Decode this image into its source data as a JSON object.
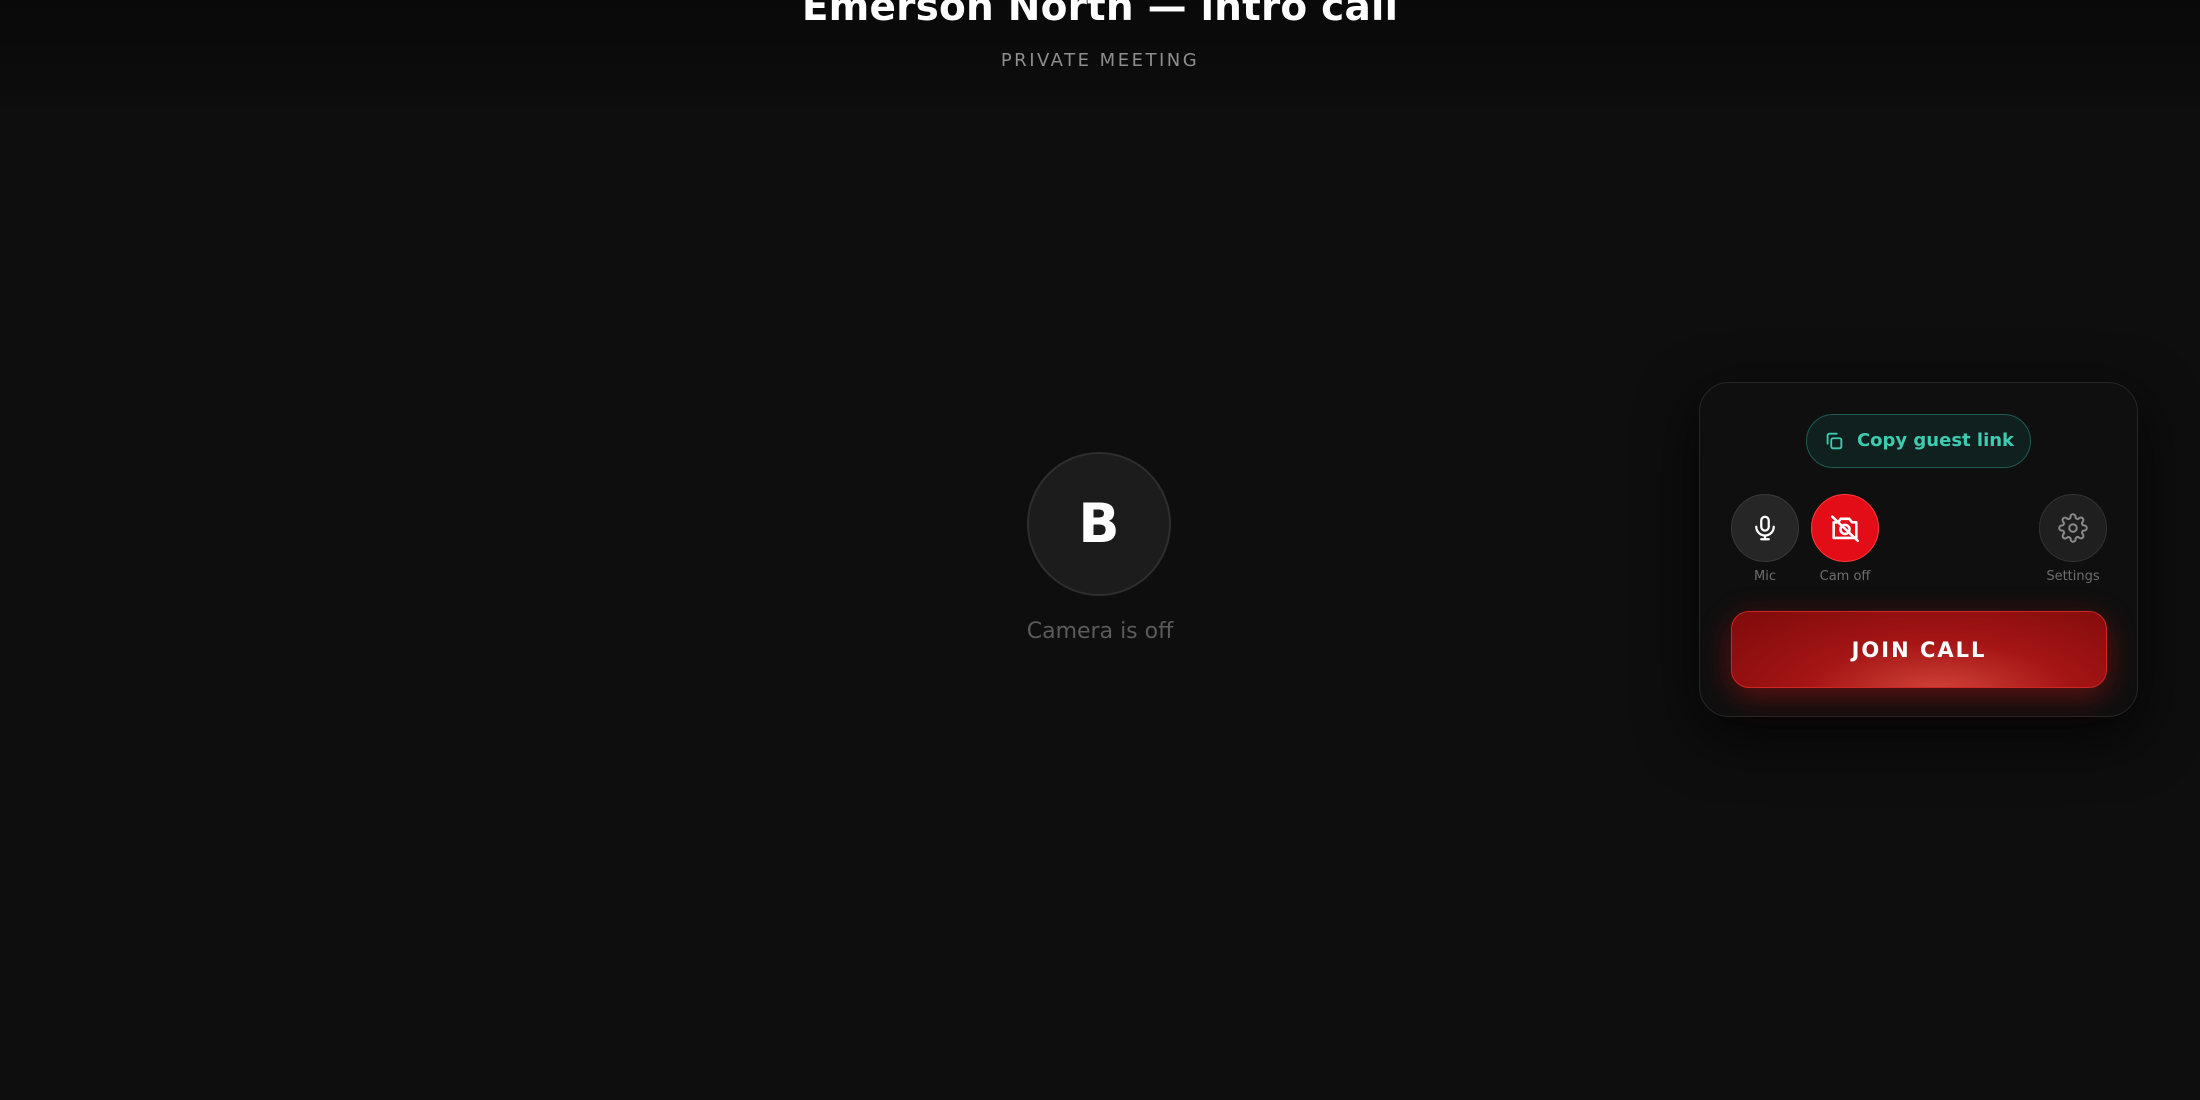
{
  "header": {
    "title": "Emerson North — intro call",
    "subtitle": "PRIVATE MEETING"
  },
  "preview": {
    "avatar_initial": "B",
    "status_text": "Camera is off"
  },
  "panel": {
    "copy_link_label": "Copy guest link",
    "controls": {
      "mic_label": "Mic",
      "cam_label": "Cam off",
      "settings_label": "Settings"
    },
    "join_label": "JOIN CALL"
  },
  "colors": {
    "background": "#0e0e0e",
    "accent_teal": "#3ecbb2",
    "cam_off_red": "#e30d18",
    "join_red": "#a51515"
  },
  "icons": {
    "copy": "copy-icon",
    "mic": "microphone-icon",
    "cam": "camera-off-icon",
    "settings": "gear-icon"
  }
}
